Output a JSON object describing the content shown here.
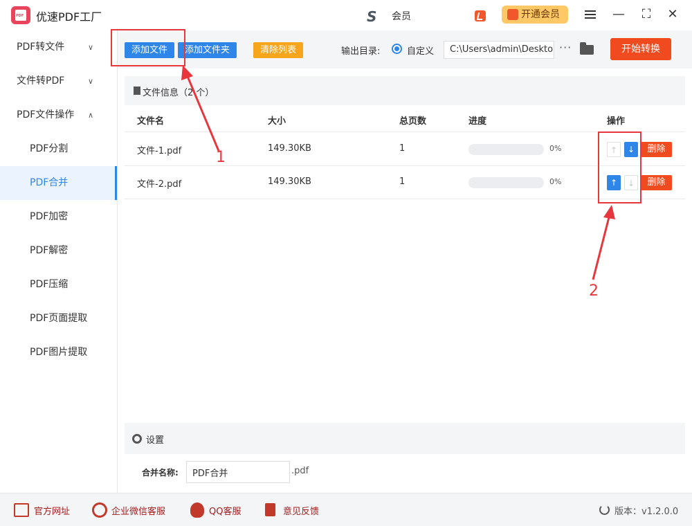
{
  "window": {
    "title": "优速PDF工厂",
    "user_name": "会员",
    "vip_button": "开通会员"
  },
  "sidebar": {
    "groups": [
      {
        "label": "PDF转文件",
        "expanded": false
      },
      {
        "label": "文件转PDF",
        "expanded": false
      },
      {
        "label": "PDF文件操作",
        "expanded": true
      }
    ],
    "sub_items": [
      {
        "label": "PDF分割",
        "active": false
      },
      {
        "label": "PDF合并",
        "active": true
      },
      {
        "label": "PDF加密",
        "active": false
      },
      {
        "label": "PDF解密",
        "active": false
      },
      {
        "label": "PDF压缩",
        "active": false
      },
      {
        "label": "PDF页面提取",
        "active": false
      },
      {
        "label": "PDF图片提取",
        "active": false
      }
    ]
  },
  "toolbar": {
    "add_file": "添加文件",
    "add_folder": "添加文件夹",
    "clear_list": "清除列表",
    "output_label": "输出目录:",
    "output_option": "自定义",
    "output_path": "C:\\Users\\admin\\Deskto",
    "more": "···",
    "start": "开始转换"
  },
  "file_panel": {
    "title": "文件信息（2 个）",
    "columns": {
      "name": "文件名",
      "size": "大小",
      "pages": "总页数",
      "progress": "进度",
      "actions": "操作"
    },
    "rows": [
      {
        "name": "文件-1.pdf",
        "size": "149.30KB",
        "pages": "1",
        "progress_pct": "0%",
        "progress": 0,
        "up_enabled": false,
        "down_enabled": true,
        "delete": "删除"
      },
      {
        "name": "文件-2.pdf",
        "size": "149.30KB",
        "pages": "1",
        "progress_pct": "0%",
        "progress": 0,
        "up_enabled": true,
        "down_enabled": false,
        "delete": "删除"
      }
    ]
  },
  "settings": {
    "title": "设置",
    "merge_name_label": "合并名称:",
    "merge_name_value": "PDF合并",
    "merge_ext": ".pdf"
  },
  "footer": {
    "website": "官方网址",
    "wechat": "企业微信客服",
    "qq": "QQ客服",
    "feedback": "意见反馈",
    "version": "版本：v1.2.0.0"
  },
  "annotations": {
    "label_1": "1",
    "label_2": "2",
    "color": "#e8373c"
  },
  "colors": {
    "primary": "#2e86e8",
    "danger": "#ef4b1f",
    "warning": "#f7a51b",
    "vip": "#ffc867"
  }
}
